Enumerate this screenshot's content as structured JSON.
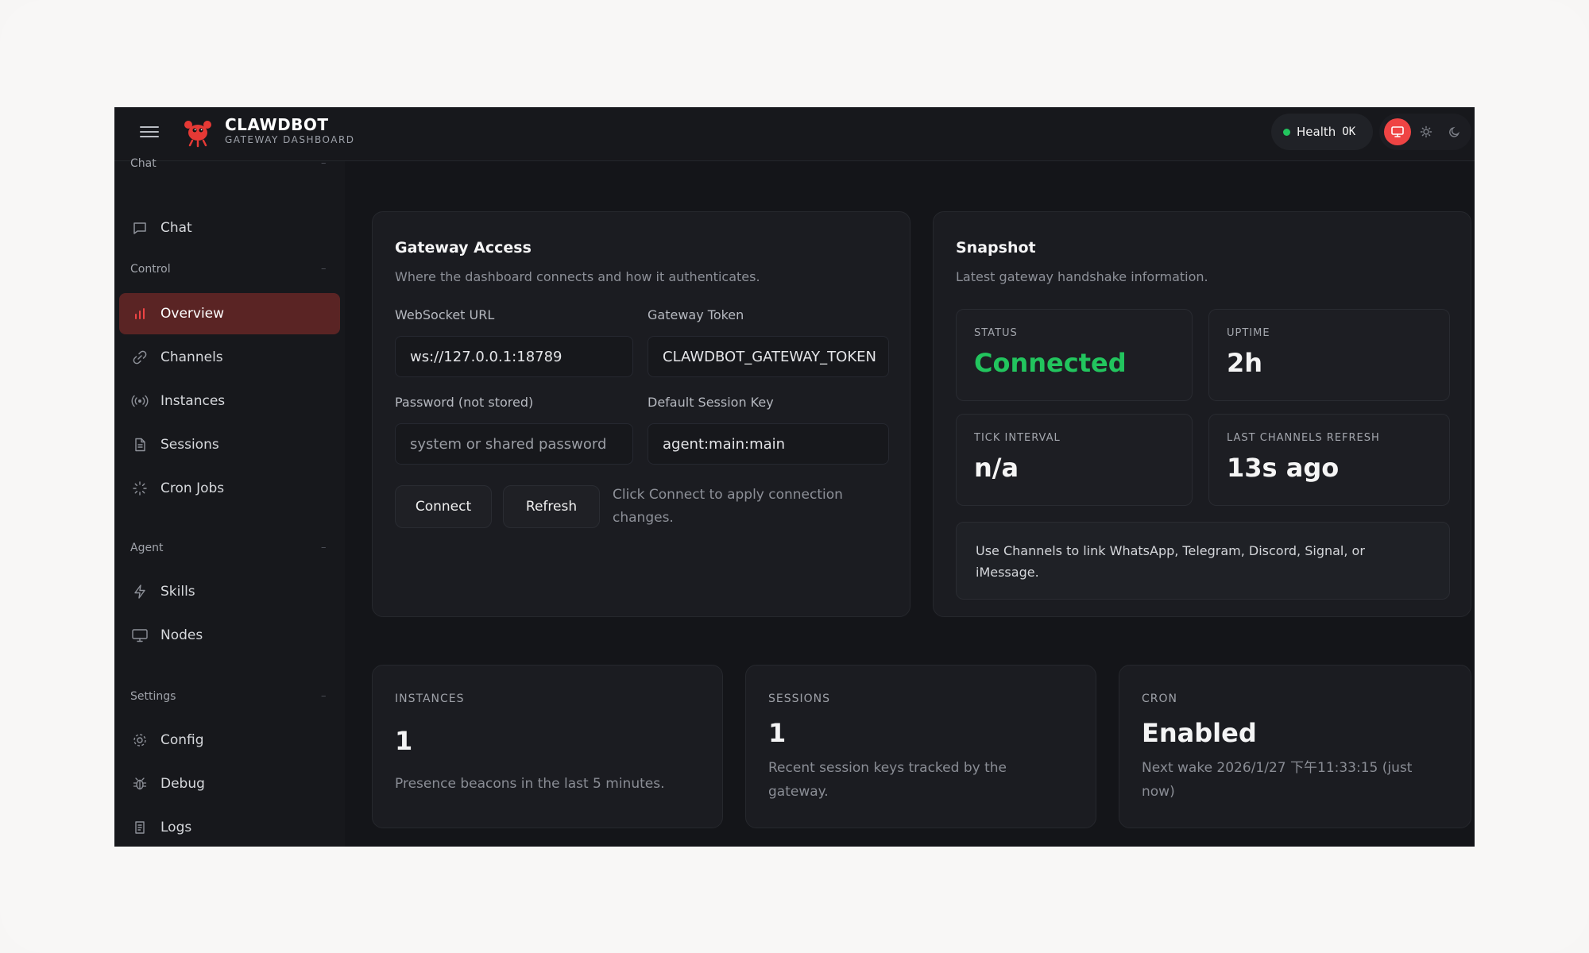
{
  "header": {
    "brand_title": "CLAWDBOT",
    "brand_subtitle": "GATEWAY DASHBOARD",
    "health_label": "Health",
    "health_status": "OK",
    "health_color": "#22c55e",
    "accent_color": "#ef4444"
  },
  "sidebar": {
    "groups": {
      "chat": "Chat",
      "control": "Control",
      "agent": "Agent",
      "settings": "Settings"
    },
    "items": [
      {
        "label": "Chat",
        "icon": "message-square-icon"
      },
      {
        "label": "Overview",
        "icon": "bar-chart-icon",
        "active": true
      },
      {
        "label": "Channels",
        "icon": "link-icon"
      },
      {
        "label": "Instances",
        "icon": "broadcast-icon"
      },
      {
        "label": "Sessions",
        "icon": "file-text-icon"
      },
      {
        "label": "Cron Jobs",
        "icon": "loader-icon"
      },
      {
        "label": "Skills",
        "icon": "zap-icon"
      },
      {
        "label": "Nodes",
        "icon": "monitor-icon"
      },
      {
        "label": "Config",
        "icon": "settings-icon"
      },
      {
        "label": "Debug",
        "icon": "bug-icon"
      },
      {
        "label": "Logs",
        "icon": "scroll-icon"
      }
    ]
  },
  "gateway_access": {
    "title": "Gateway Access",
    "subtitle": "Where the dashboard connects and how it authenticates.",
    "websocket_label": "WebSocket URL",
    "websocket_value": "ws://127.0.0.1:18789",
    "token_label": "Gateway Token",
    "token_value": "CLAWDBOT_GATEWAY_TOKEN",
    "password_label": "Password (not stored)",
    "password_placeholder": "system or shared password",
    "session_key_label": "Default Session Key",
    "session_key_value": "agent:main:main",
    "connect_label": "Connect",
    "refresh_label": "Refresh",
    "hint": "Click Connect to apply connection changes."
  },
  "snapshot": {
    "title": "Snapshot",
    "subtitle": "Latest gateway handshake information.",
    "status_label": "STATUS",
    "status_value": "Connected",
    "uptime_label": "UPTIME",
    "uptime_value": "2h",
    "tick_label": "TICK INTERVAL",
    "tick_value": "n/a",
    "refresh_label": "LAST CHANNELS REFRESH",
    "refresh_value": "13s ago",
    "info": "Use Channels to link WhatsApp, Telegram, Discord, Signal, or iMessage."
  },
  "stats": {
    "instances": {
      "label": "INSTANCES",
      "value": "1",
      "desc": "Presence beacons in the last 5 minutes."
    },
    "sessions": {
      "label": "SESSIONS",
      "value": "1",
      "desc": "Recent session keys tracked by the gateway."
    },
    "cron": {
      "label": "CRON",
      "value": "Enabled",
      "desc": "Next wake 2026/1/27 下午11:33:15 (just now)"
    }
  }
}
